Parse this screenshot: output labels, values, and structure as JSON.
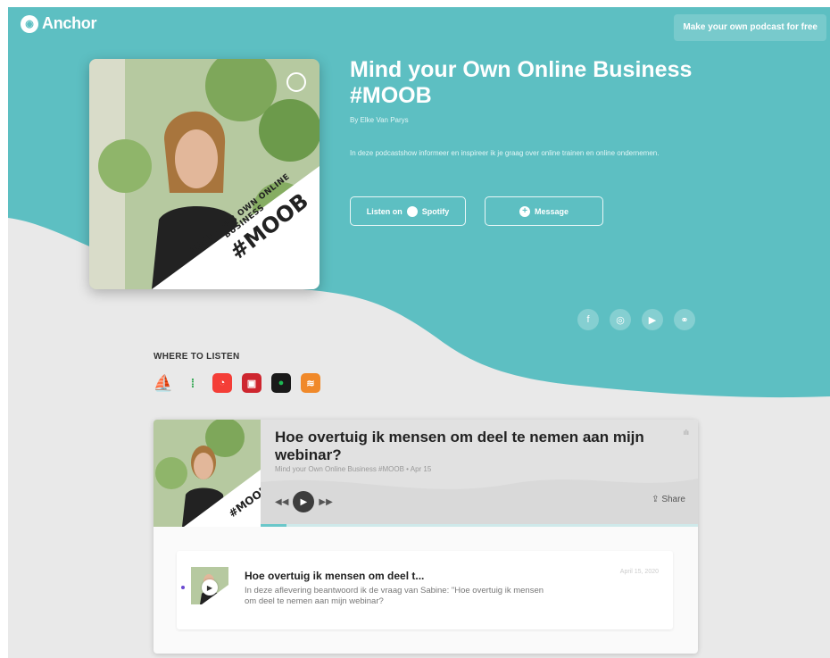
{
  "header": {
    "logo_text": "Anchor",
    "cta_label": "Make your own podcast for free"
  },
  "podcast": {
    "title": "Mind your Own Online Business #MOOB",
    "author": "By Elke Van Parys",
    "description": "In deze podcastshow informeer en inspireer ik je graag over online trainen en online ondernemen.",
    "listen_label": "Listen on",
    "listen_platform": "Spotify",
    "message_label": "Message",
    "cover_text_line1": "MIND YOUR OWN ONLINE",
    "cover_text_line2": "BUSINESS",
    "cover_tag": "#MOOB"
  },
  "social": [
    "facebook-icon",
    "instagram-icon",
    "youtube-icon",
    "link-icon"
  ],
  "where_to_listen": {
    "label": "WHERE TO LISTEN",
    "platforms": [
      {
        "name": "anchor-icon",
        "color": "#2f5bd6"
      },
      {
        "name": "google-podcasts-icon",
        "color": "#ffffff"
      },
      {
        "name": "pocket-casts-icon",
        "color": "#f43e37"
      },
      {
        "name": "radiopublic-icon",
        "color": "#ce262f"
      },
      {
        "name": "spotify-icon",
        "color": "#1a1a1a"
      },
      {
        "name": "rss-icon",
        "color": "#f0892a"
      }
    ]
  },
  "player": {
    "episode_title": "Hoe overtuig ik mensen om deel te nemen aan mijn webinar?",
    "episode_sub": "Mind your Own Online Business #MOOB • Apr 15",
    "share_label": "Share",
    "progress": 0.06
  },
  "episode_card": {
    "title": "Hoe overtuig ik mensen om deel t...",
    "description": "In deze aflevering beantwoord ik de vraag van Sabine: \"Hoe overtuig ik mensen om deel te nemen aan mijn webinar?",
    "date": "April 15, 2020"
  },
  "colors": {
    "teal": "#5dbfc2",
    "background": "#e9e9e9"
  }
}
